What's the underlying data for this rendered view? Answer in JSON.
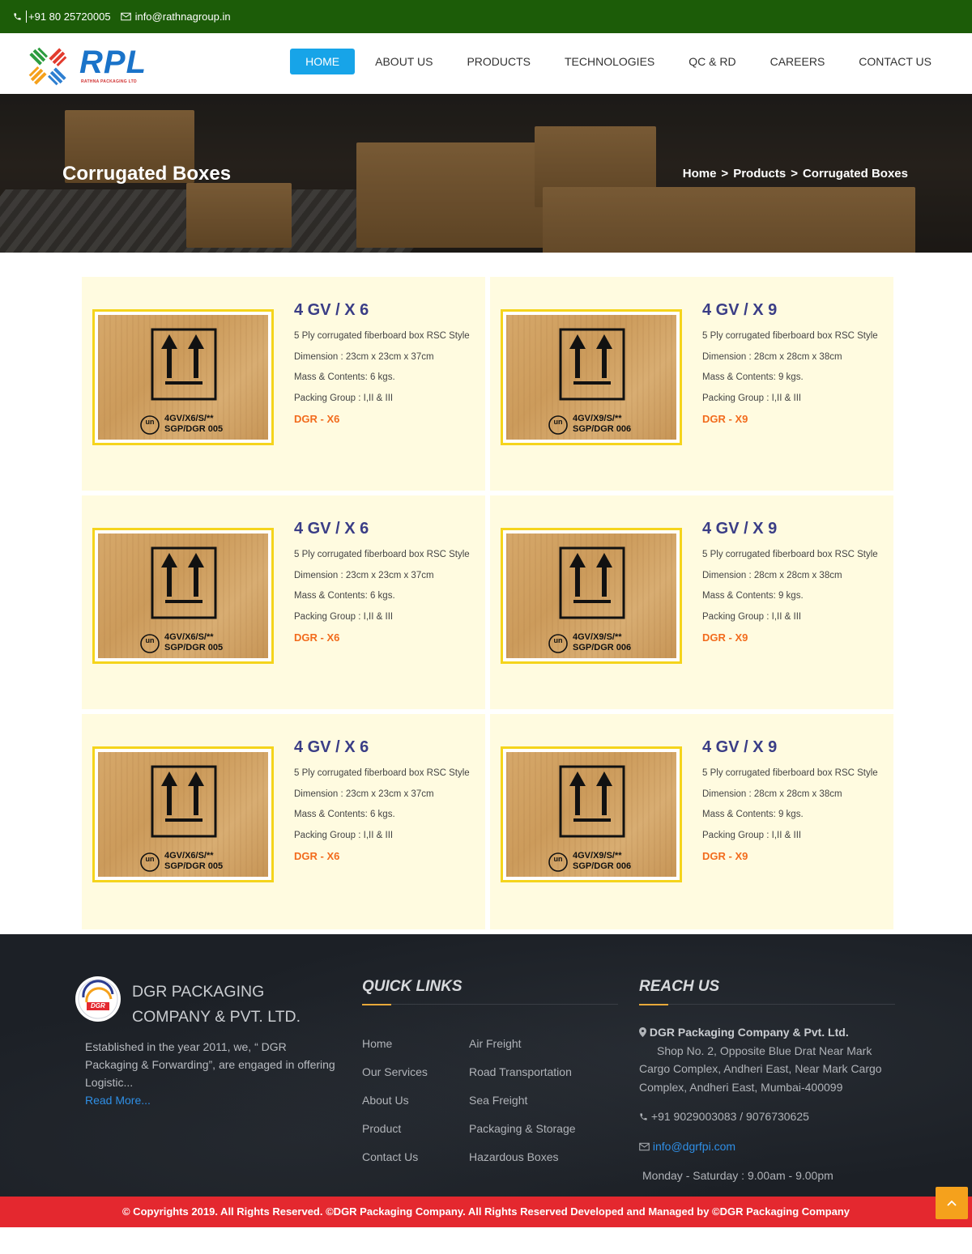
{
  "topbar": {
    "phone": "+91 80 25720005",
    "email": "info@rathnagroup.in",
    "bg_color": "#1c5c08"
  },
  "header": {
    "logo_text": "RPL",
    "logo_sub": "RATHNA PACKAGING LTD",
    "nav": [
      {
        "label": "HOME",
        "active": true
      },
      {
        "label": "ABOUT US"
      },
      {
        "label": "PRODUCTS"
      },
      {
        "label": "TECHNOLOGIES"
      },
      {
        "label": "QC & RD"
      },
      {
        "label": "CAREERS"
      },
      {
        "label": "CONTACT US"
      }
    ],
    "accent_color": "#17a4e8"
  },
  "hero": {
    "title": "Corrugated Boxes",
    "breadcrumb": [
      "Home",
      "Products",
      "Corrugated Boxes"
    ],
    "separator": ">"
  },
  "products": [
    {
      "title": "4 GV / X 6",
      "desc": "5 Ply corrugated fiberboard box RSC Style",
      "dimension": "Dimension : 23cm x 23cm x 37cm",
      "mass": "Mass & Contents: 6 kgs.",
      "group": "Packing Group : I,II & III",
      "code": "DGR - X6",
      "label1": "4GV/X6/S/**",
      "label2": "SGP/DGR 005"
    },
    {
      "title": "4 GV / X 9",
      "desc": "5 Ply corrugated fiberboard box RSC Style",
      "dimension": "Dimension : 28cm x 28cm x 38cm",
      "mass": "Mass & Contents: 9 kgs.",
      "group": "Packing Group : I,II & III",
      "code": "DGR - X9",
      "label1": "4GV/X9/S/**",
      "label2": "SGP/DGR 006"
    },
    {
      "title": "4 GV / X 6",
      "desc": "5 Ply corrugated fiberboard box RSC Style",
      "dimension": "Dimension : 23cm x 23cm x 37cm",
      "mass": "Mass & Contents: 6 kgs.",
      "group": "Packing Group : I,II & III",
      "code": "DGR - X6",
      "label1": "4GV/X6/S/**",
      "label2": "SGP/DGR 005"
    },
    {
      "title": "4 GV / X 9",
      "desc": "5 Ply corrugated fiberboard box RSC Style",
      "dimension": "Dimension : 28cm x 28cm x 38cm",
      "mass": "Mass & Contents: 9 kgs.",
      "group": "Packing Group : I,II & III",
      "code": "DGR - X9",
      "label1": "4GV/X9/S/**",
      "label2": "SGP/DGR 006"
    },
    {
      "title": "4 GV / X 6",
      "desc": "5 Ply corrugated fiberboard box RSC Style",
      "dimension": "Dimension : 23cm x 23cm x 37cm",
      "mass": "Mass & Contents: 6 kgs.",
      "group": "Packing Group : I,II & III",
      "code": "DGR - X6",
      "label1": "4GV/X6/S/**",
      "label2": "SGP/DGR 005"
    },
    {
      "title": "4 GV / X 9",
      "desc": "5 Ply corrugated fiberboard box RSC Style",
      "dimension": "Dimension : 28cm x 28cm x 38cm",
      "mass": "Mass & Contents: 9 kgs.",
      "group": "Packing Group : I,II & III",
      "code": "DGR - X9",
      "label1": "4GV/X9/S/**",
      "label2": "SGP/DGR 006"
    }
  ],
  "un_mark": "un",
  "footer": {
    "company_name": "DGR PACKAGING COMPANY & PVT. LTD.",
    "logo_text": "DGR",
    "about": "Established in the year 2011, we, “ DGR Packaging & Forwarding”, are engaged in offering Logistic...",
    "read_more": "Read More...",
    "quick_links_title": "QUICK LINKS",
    "links_col1": [
      "Home",
      "Our Services",
      "About Us",
      "Product",
      "Contact Us"
    ],
    "links_col2": [
      "Air Freight",
      "Road Transportation",
      "Sea Freight",
      "Packaging & Storage",
      "Hazardous Boxes"
    ],
    "reach_title": "REACH US",
    "reach_company": "DGR Packaging Company & Pvt. Ltd.",
    "address": "Shop No. 2, Opposite Blue Drat Near Mark Cargo Complex, Andheri East, Near Mark Cargo Complex, Andheri East, Mumbai-400099",
    "phones": "+91 9029003083 / 9076730625",
    "email": "info@dgrfpi.com",
    "hours": "Monday - Saturday : 9.00am - 9.00pm",
    "copyright": "© Copyrights 2019. All Rights Reserved. ©DGR Packaging Company. All Rights Reserved Developed and Managed by ©DGR Packaging Company"
  },
  "colors": {
    "title_blue": "#3a3d86",
    "dgr_orange": "#f26b1d",
    "card_bg": "#fffbe0",
    "frame_yellow": "#f5d41c",
    "footer_bg": "#1c2026",
    "copy_red": "#e4282f",
    "totop_orange": "#f5a11c"
  }
}
